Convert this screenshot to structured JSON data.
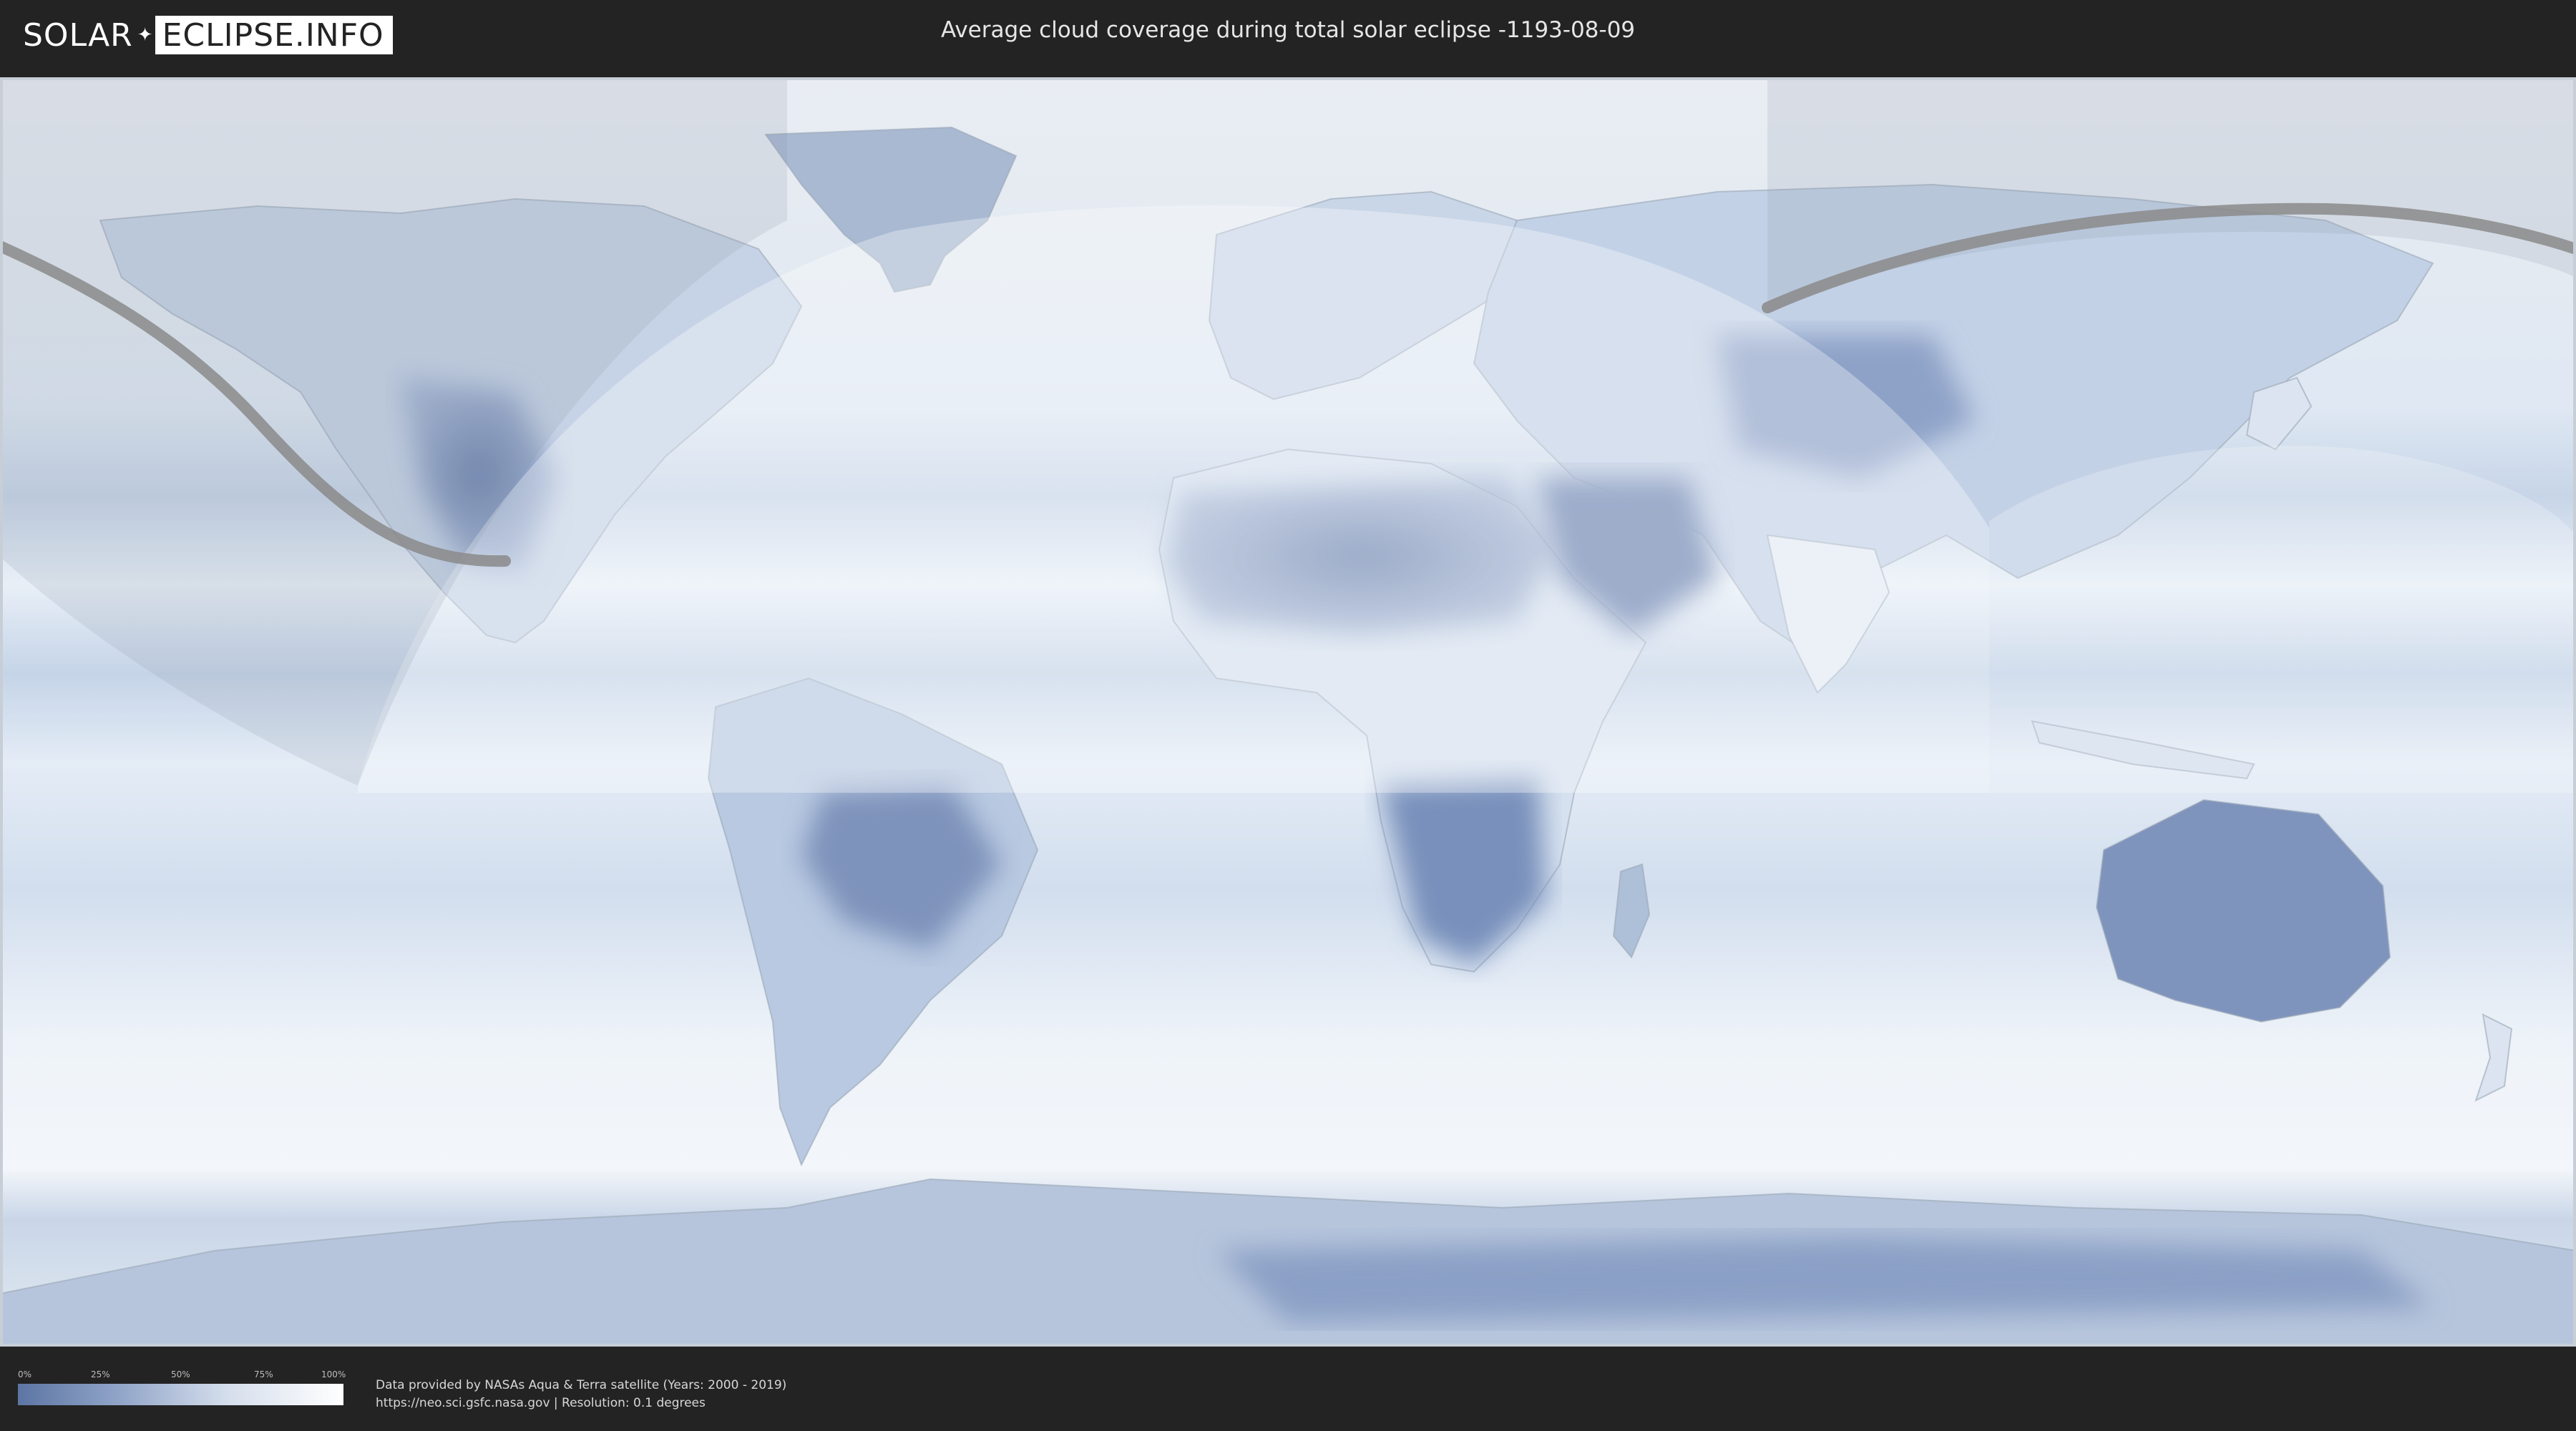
{
  "header": {
    "logo": {
      "part1": "SOLAR",
      "mark": "✦",
      "part2": "ECLIPSE.INFO"
    },
    "title": "Average cloud coverage during total solar eclipse -1193-08-09"
  },
  "map": {
    "colors": {
      "ocean_clear": "#f2f6fb",
      "cloud_low": "#5c75a3",
      "eclipse_path": "#8a8a8a",
      "visibility_zone": "#ffffff"
    }
  },
  "legend": {
    "ticks": [
      "0%",
      "25%",
      "50%",
      "75%",
      "100%"
    ],
    "gradient_from": "#5c75a3",
    "gradient_to": "#ffffff"
  },
  "credits": {
    "line1": "Data provided by NASAs Aqua & Terra satellite (Years: 2000 - 2019)",
    "line2": "https://neo.sci.gsfc.nasa.gov | Resolution: 0.1 degrees"
  }
}
